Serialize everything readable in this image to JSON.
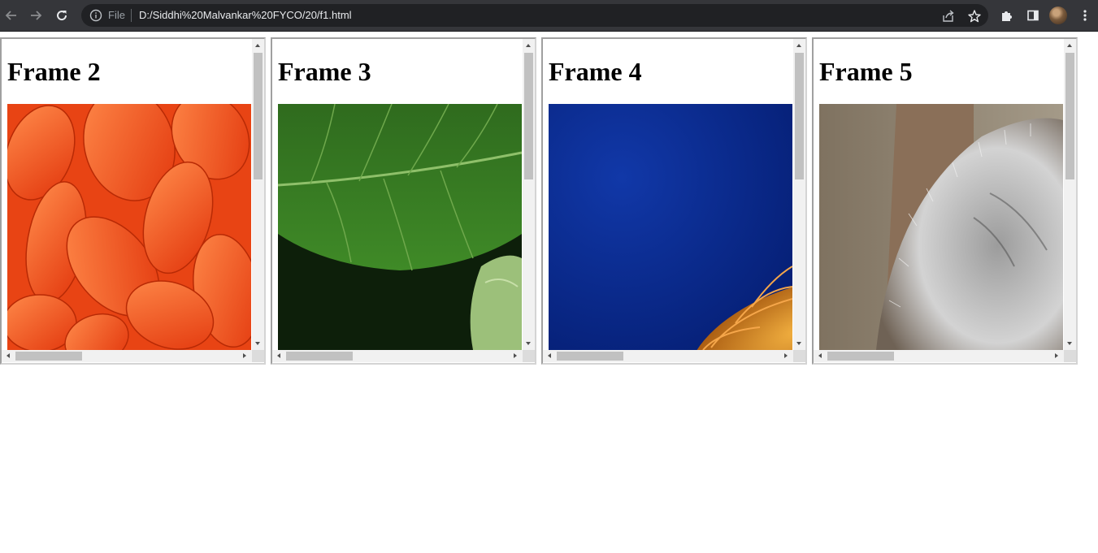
{
  "browser": {
    "omnibox": {
      "security_chip": "File",
      "url": "D:/Siddhi%20Malvankar%20FYCO/20/f1.html"
    },
    "icons": {
      "back": "arrow-left-icon",
      "forward": "arrow-right-icon",
      "reload": "reload-icon",
      "info": "info-icon",
      "share": "share-icon",
      "bookmark": "star-icon",
      "extensions": "puzzle-icon",
      "side_panel": "side-panel-icon",
      "profile": "avatar",
      "menu": "kebab-menu-icon"
    }
  },
  "frames": [
    {
      "title": "Frame 2",
      "image": "orange-dahlia-petals"
    },
    {
      "title": "Frame 3",
      "image": "green-leaf"
    },
    {
      "title": "Frame 4",
      "image": "jellyfish-on-blue"
    },
    {
      "title": "Frame 5",
      "image": "koala-fur"
    }
  ]
}
